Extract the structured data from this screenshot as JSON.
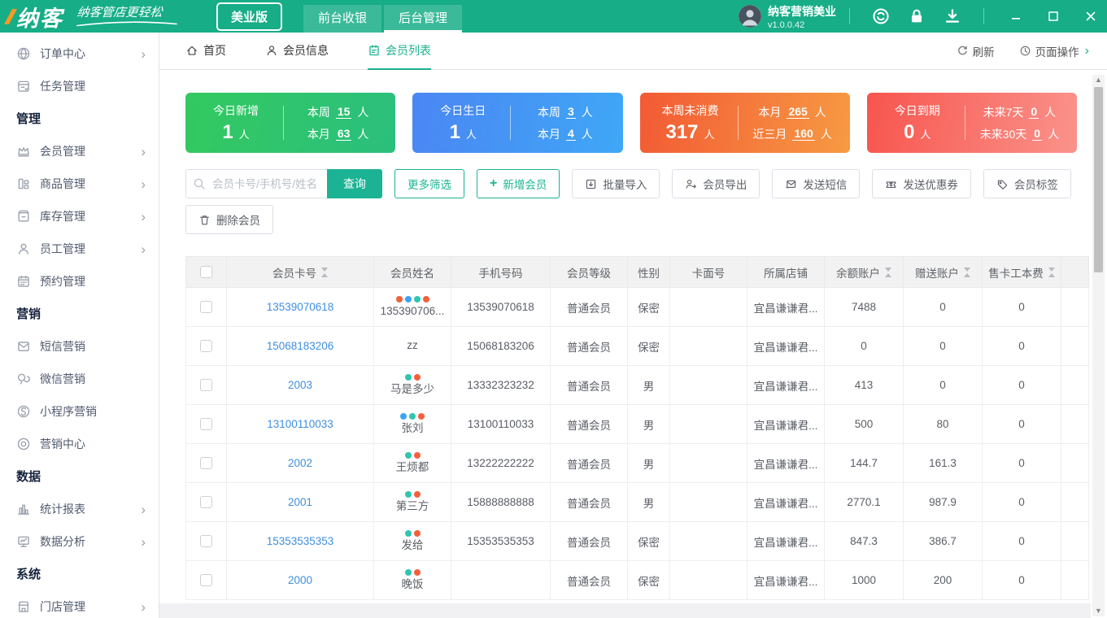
{
  "theme": {
    "primary": "#16ad87",
    "link_blue": "#3f8fdf",
    "table_dot_colors": {
      "red": "#f4603b",
      "blue": "#3ba3f2",
      "teal": "#2fc6ad"
    }
  },
  "titlebar": {
    "brand": {
      "logo": "纳客",
      "tagline": "纳客管店更轻松",
      "edition": "美业版"
    },
    "nav": [
      {
        "label": "前台收银",
        "active": false
      },
      {
        "label": "后台管理",
        "active": true
      }
    ],
    "user": {
      "name": "纳客营销美业",
      "version": "v1.0.0.42"
    }
  },
  "sidebar": {
    "groups": [
      {
        "title": "",
        "items": [
          {
            "label": "订单中心",
            "icon": "globe",
            "arrow": true
          },
          {
            "label": "任务管理",
            "icon": "task",
            "arrow": false
          }
        ]
      },
      {
        "title": "管理",
        "items": [
          {
            "label": "会员管理",
            "icon": "crown",
            "arrow": true
          },
          {
            "label": "商品管理",
            "icon": "goods",
            "arrow": true
          },
          {
            "label": "库存管理",
            "icon": "box",
            "arrow": true
          },
          {
            "label": "员工管理",
            "icon": "person",
            "arrow": true
          },
          {
            "label": "预约管理",
            "icon": "calendar",
            "arrow": false
          }
        ]
      },
      {
        "title": "营销",
        "items": [
          {
            "label": "短信营销",
            "icon": "mail",
            "arrow": false
          },
          {
            "label": "微信营销",
            "icon": "wechat",
            "arrow": false
          },
          {
            "label": "小程序营销",
            "icon": "miniapp",
            "arrow": false
          },
          {
            "label": "营销中心",
            "icon": "target",
            "arrow": false
          }
        ]
      },
      {
        "title": "数据",
        "items": [
          {
            "label": "统计报表",
            "icon": "chart",
            "arrow": true
          },
          {
            "label": "数据分析",
            "icon": "monitor",
            "arrow": true
          }
        ]
      },
      {
        "title": "系统",
        "items": [
          {
            "label": "门店管理",
            "icon": "store",
            "arrow": true
          }
        ]
      }
    ]
  },
  "tabs": {
    "items": [
      {
        "label": "首页",
        "icon": "home",
        "active": false
      },
      {
        "label": "会员信息",
        "icon": "person",
        "active": false
      },
      {
        "label": "会员列表",
        "icon": "list",
        "active": true
      }
    ],
    "actions": {
      "refresh": "刷新",
      "page_ops": "页面操作"
    }
  },
  "stats_cards": [
    {
      "title": "今日新增",
      "value": "1",
      "unit": "人",
      "gradient": [
        "#33c95f",
        "#2bbf7e"
      ],
      "lines": [
        {
          "label": "本周",
          "value": "15",
          "unit": "人"
        },
        {
          "label": "本月",
          "value": "63",
          "unit": "人"
        }
      ]
    },
    {
      "title": "今日生日",
      "value": "1",
      "unit": "人",
      "gradient": [
        "#4b86f3",
        "#3fa7f6"
      ],
      "lines": [
        {
          "label": "本周",
          "value": "3",
          "unit": "人"
        },
        {
          "label": "本月",
          "value": "4",
          "unit": "人"
        }
      ]
    },
    {
      "title": "本周未消费",
      "value": "317",
      "unit": "人",
      "gradient": [
        "#f25a35",
        "#f79a43"
      ],
      "lines": [
        {
          "label": "本月",
          "value": "265",
          "unit": "人"
        },
        {
          "label": "近三月",
          "value": "160",
          "unit": "人"
        }
      ]
    },
    {
      "title": "今日到期",
      "value": "0",
      "unit": "人",
      "gradient": [
        "#f7554e",
        "#fa938b"
      ],
      "lines": [
        {
          "label": "未来7天",
          "value": "0",
          "unit": "人"
        },
        {
          "label": "未来30天",
          "value": "0",
          "unit": "人"
        }
      ]
    }
  ],
  "toolbar": {
    "search_placeholder": "会员卡号/手机号/姓名",
    "search_button": "查询",
    "more_filter": "更多筛选",
    "add_member_plus": "+",
    "add_member": "新增会员",
    "batch_import": "批量导入",
    "member_export": "会员导出",
    "send_sms": "发送短信",
    "send_coupon": "发送优惠券",
    "member_tag": "会员标签",
    "delete_member": "删除会员"
  },
  "table": {
    "columns": [
      {
        "label": "",
        "type": "checkbox"
      },
      {
        "label": "会员卡号",
        "sortable": true
      },
      {
        "label": "会员姓名"
      },
      {
        "label": "手机号码"
      },
      {
        "label": "会员等级"
      },
      {
        "label": "性别"
      },
      {
        "label": "卡面号"
      },
      {
        "label": "所属店铺"
      },
      {
        "label": "余额账户",
        "sortable": true
      },
      {
        "label": "赠送账户",
        "sortable": true
      },
      {
        "label": "售卡工本费",
        "sortable": true
      },
      {
        "label": ""
      }
    ],
    "rows": [
      {
        "card_no": "13539070618",
        "dots": [
          "red",
          "blue",
          "teal",
          "red"
        ],
        "name": "135390706...",
        "phone": "13539070618",
        "level": "普通会员",
        "gender": "保密",
        "card_face": "",
        "store": "宜昌谦谦君...",
        "balance": "7488",
        "gift": "0",
        "fee": "0"
      },
      {
        "card_no": "15068183206",
        "dots": [],
        "name": "zz",
        "phone": "15068183206",
        "level": "普通会员",
        "gender": "保密",
        "card_face": "",
        "store": "宜昌谦谦君...",
        "balance": "0",
        "gift": "0",
        "fee": "0"
      },
      {
        "card_no": "2003",
        "dots": [
          "teal",
          "red"
        ],
        "name": "马是多少",
        "phone": "13332323232",
        "level": "普通会员",
        "gender": "男",
        "card_face": "",
        "store": "宜昌谦谦君...",
        "balance": "413",
        "gift": "0",
        "fee": "0"
      },
      {
        "card_no": "13100110033",
        "dots": [
          "blue",
          "teal",
          "red"
        ],
        "name": "张刘",
        "phone": "13100110033",
        "level": "普通会员",
        "gender": "男",
        "card_face": "",
        "store": "宜昌谦谦君...",
        "balance": "500",
        "gift": "80",
        "fee": "0"
      },
      {
        "card_no": "2002",
        "dots": [
          "teal",
          "red"
        ],
        "name": "王烦都",
        "phone": "13222222222",
        "level": "普通会员",
        "gender": "男",
        "card_face": "",
        "store": "宜昌谦谦君...",
        "balance": "144.7",
        "gift": "161.3",
        "fee": "0"
      },
      {
        "card_no": "2001",
        "dots": [
          "teal",
          "red"
        ],
        "name": "第三方",
        "phone": "15888888888",
        "level": "普通会员",
        "gender": "男",
        "card_face": "",
        "store": "宜昌谦谦君...",
        "balance": "2770.1",
        "gift": "987.9",
        "fee": "0"
      },
      {
        "card_no": "15353535353",
        "dots": [
          "teal",
          "red"
        ],
        "name": "发给",
        "phone": "15353535353",
        "level": "普通会员",
        "gender": "保密",
        "card_face": "",
        "store": "宜昌谦谦君...",
        "balance": "847.3",
        "gift": "386.7",
        "fee": "0"
      },
      {
        "card_no": "2000",
        "dots": [
          "teal",
          "red"
        ],
        "name": "晚饭",
        "phone": "",
        "level": "普通会员",
        "gender": "保密",
        "card_face": "",
        "store": "宜昌谦谦君...",
        "balance": "1000",
        "gift": "200",
        "fee": "0"
      }
    ]
  }
}
